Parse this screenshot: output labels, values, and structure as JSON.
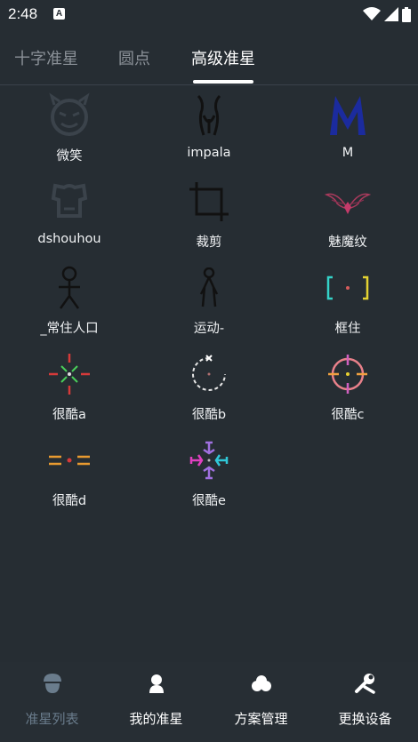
{
  "status_bar": {
    "time": "2:48",
    "notification_icon": "A"
  },
  "tabs": [
    {
      "label": "十字准星"
    },
    {
      "label": "圆点"
    },
    {
      "label": "高级准星"
    }
  ],
  "crosshairs": [
    {
      "label": "微笑",
      "icon": "smile-devil-icon"
    },
    {
      "label": "impala",
      "icon": "impala-icon"
    },
    {
      "label": "M",
      "icon": "m-logo-icon"
    },
    {
      "label": "dshouhou",
      "icon": "shield-face-icon"
    },
    {
      "label": "裁剪",
      "icon": "crop-icon"
    },
    {
      "label": "魅魔纹",
      "icon": "succubus-tattoo-icon"
    },
    {
      "label": "_常住人口",
      "icon": "stick-figure-icon"
    },
    {
      "label": "运动-",
      "icon": "running-figure-icon"
    },
    {
      "label": "框住",
      "icon": "bracket-dot-icon"
    },
    {
      "label": "很酷a",
      "icon": "cool-a-crosshair-icon"
    },
    {
      "label": "很酷b",
      "icon": "cool-b-crosshair-icon"
    },
    {
      "label": "很酷c",
      "icon": "cool-c-crosshair-icon"
    },
    {
      "label": "很酷d",
      "icon": "cool-d-crosshair-icon"
    },
    {
      "label": "很酷e",
      "icon": "cool-e-crosshair-icon"
    }
  ],
  "bottom_nav": [
    {
      "label": "准星列表",
      "icon": "acorn-icon"
    },
    {
      "label": "我的准星",
      "icon": "user-icon"
    },
    {
      "label": "方案管理",
      "icon": "cloud-icon"
    },
    {
      "label": "更换设备",
      "icon": "tools-icon"
    }
  ],
  "colors": {
    "background": "#262d33",
    "active_nav": "#6a7c8c",
    "inactive_tab": "#8a9097",
    "active_tab": "#ffffff"
  }
}
